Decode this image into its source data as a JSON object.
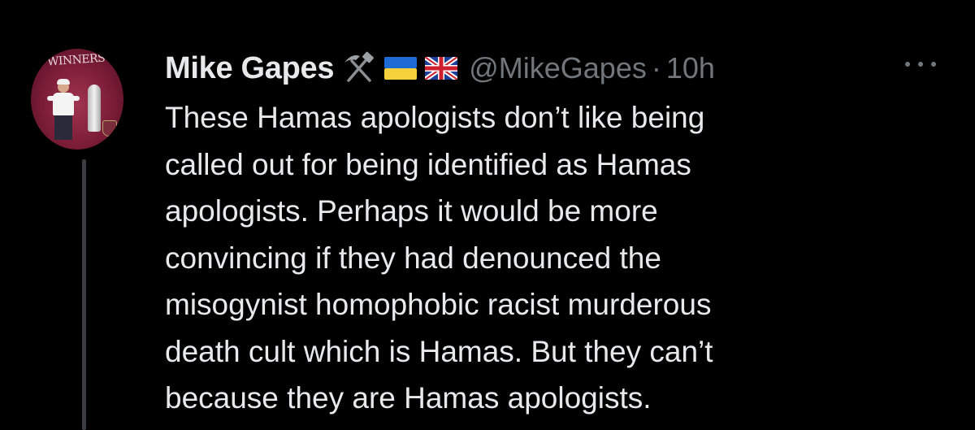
{
  "tweet": {
    "avatar": {
      "alt": "Mike Gapes profile photo",
      "banner_text": "WINNERS"
    },
    "author": {
      "display_name": "Mike Gapes",
      "emojis": [
        "hammer-and-pick-icon",
        "ukraine-flag-icon",
        "uk-flag-icon"
      ],
      "handle": "@MikeGapes",
      "separator": "·",
      "time": "10h"
    },
    "more_icon": "more-horizontal-icon",
    "text_lines": [
      "These Hamas apologists don’t like being",
      "called out for being identified as Hamas",
      "apologists.  Perhaps it would be more",
      "convincing if they had denounced the",
      "misogynist homophobic racist murderous",
      "death cult which is Hamas. But they can’t",
      "because they are Hamas apologists."
    ]
  },
  "colors": {
    "background": "#000000",
    "primary_text": "#e7e9ea",
    "secondary_text": "#71767b",
    "thread_line": "#3a3d41"
  }
}
